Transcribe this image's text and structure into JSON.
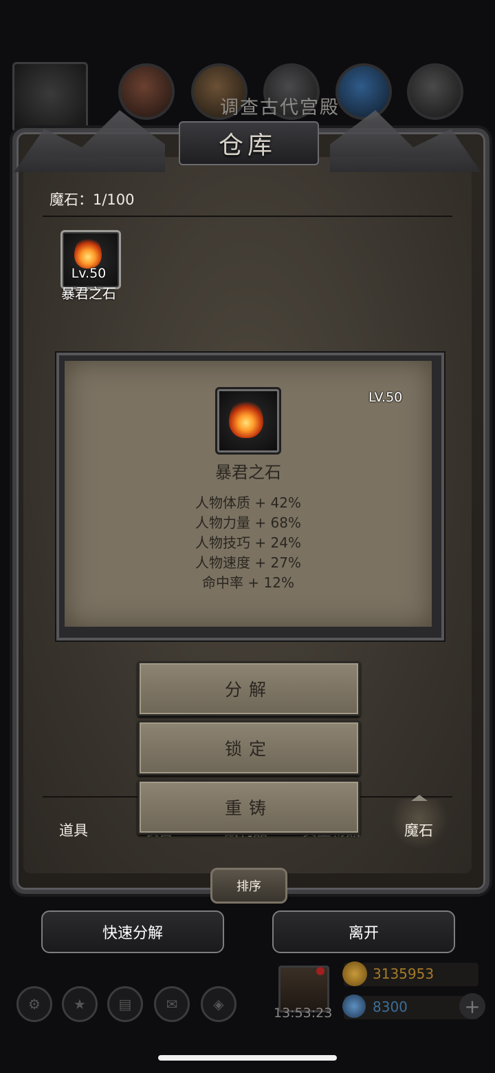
{
  "hud": {
    "quest_title": "调查古代宫殿"
  },
  "warehouse": {
    "title": "仓库",
    "count_label": "魔石：1/100",
    "item": {
      "level": "Lv.50",
      "name": "暴君之石"
    }
  },
  "detail": {
    "level": "LV.50",
    "name": "暴君之石",
    "stats": [
      "人物体质 + 42%",
      "人物力量 + 68%",
      "人物技巧 + 24%",
      "人物速度 + 27%",
      "命中率 + 12%"
    ],
    "actions": {
      "decompose": "分解",
      "lock": "锁定",
      "reforge": "重铸"
    }
  },
  "tabs": {
    "items": "道具",
    "equipment": "装备",
    "consumables": "战利品",
    "valuables": "贵重物品",
    "magic_stones": "魔石"
  },
  "sort_label": "排序",
  "quick_decompose_label": "快速分解",
  "leave_label": "离开",
  "bottom_hud": {
    "timer": "13:53:23",
    "gold": "3135953",
    "gems": "8300"
  },
  "colors": {
    "panel_bg": "#7b7262",
    "frame_bg": "#3b362f",
    "accent_text": "#2a2620"
  }
}
